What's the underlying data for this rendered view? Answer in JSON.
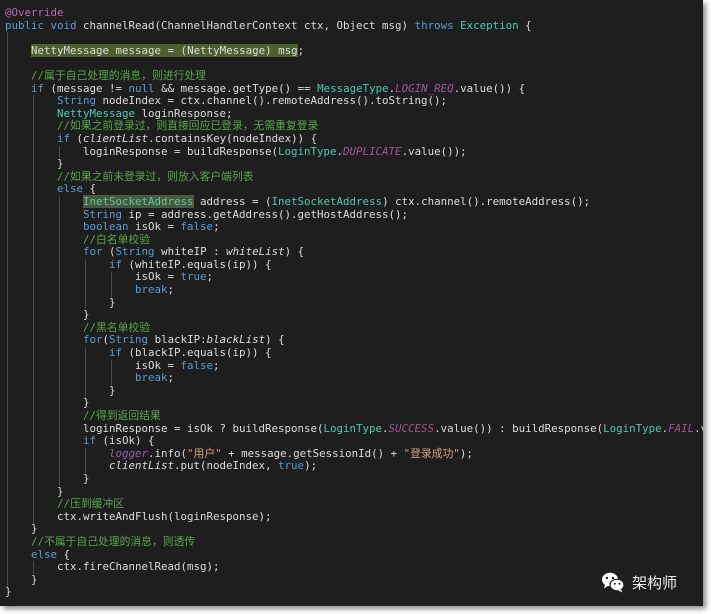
{
  "editor": {
    "lines": [
      [
        [
          "an",
          "@Override"
        ]
      ],
      [
        [
          "kw",
          "public"
        ],
        [
          "p",
          " "
        ],
        [
          "kw",
          "void"
        ],
        [
          "p",
          " channelRead(ChannelHandlerContext ctx, Object msg) "
        ],
        [
          "kw",
          "throws"
        ],
        [
          "p",
          " "
        ],
        [
          "ty",
          "Exception"
        ],
        [
          "p",
          " {"
        ]
      ],
      [],
      [
        [
          "p",
          "    "
        ],
        [
          "hl",
          "NettyMessage"
        ],
        [
          "hl",
          " message = "
        ],
        [
          "hl",
          "("
        ],
        [
          "hl",
          "NettyMessage"
        ],
        [
          "hl",
          ") msg"
        ],
        [
          "p",
          ";"
        ]
      ],
      [],
      [
        [
          "p",
          "    "
        ],
        [
          "cm",
          "//属于自己处理的消息，则进行处理"
        ]
      ],
      [
        [
          "p",
          "    "
        ],
        [
          "kw",
          "if"
        ],
        [
          "p",
          " (message != "
        ],
        [
          "kw",
          "null"
        ],
        [
          "p",
          " && message.getType() == "
        ],
        [
          "ty",
          "MessageType"
        ],
        [
          "p",
          "."
        ],
        [
          "cst",
          "LOGIN_REQ"
        ],
        [
          "p",
          ".value()) {"
        ]
      ],
      [
        [
          "p",
          "        "
        ],
        [
          "kw",
          "String"
        ],
        [
          "p",
          " nodeIndex = ctx.channel().remoteAddress().toString();"
        ]
      ],
      [
        [
          "p",
          "        "
        ],
        [
          "ty",
          "NettyMessage"
        ],
        [
          "p",
          " loginResponse;"
        ]
      ],
      [
        [
          "p",
          "        "
        ],
        [
          "cm",
          "//如果之前登录过，则直接回应已登录，无需重复登录"
        ]
      ],
      [
        [
          "p",
          "        "
        ],
        [
          "kw",
          "if"
        ],
        [
          "p",
          " ("
        ],
        [
          "fd",
          "clientList"
        ],
        [
          "p",
          ".containsKey(nodeIndex)) {"
        ]
      ],
      [
        [
          "p",
          "            loginResponse = buildResponse("
        ],
        [
          "ty",
          "LoginType"
        ],
        [
          "p",
          "."
        ],
        [
          "cst",
          "DUPLICATE"
        ],
        [
          "p",
          ".value());"
        ]
      ],
      [
        [
          "p",
          "        }"
        ]
      ],
      [
        [
          "p",
          "        "
        ],
        [
          "cm",
          "//如果之前未登录过，则放入客户端列表"
        ]
      ],
      [
        [
          "p",
          "        "
        ],
        [
          "kw",
          "else"
        ],
        [
          "p",
          " {"
        ]
      ],
      [
        [
          "p",
          "            "
        ],
        [
          "tyhl",
          "InetSocketAddress"
        ],
        [
          "p",
          " address = ("
        ],
        [
          "ty",
          "InetSocketAddress"
        ],
        [
          "p",
          ") ctx.channel().remoteAddress();"
        ]
      ],
      [
        [
          "p",
          "            "
        ],
        [
          "kw",
          "String"
        ],
        [
          "p",
          " ip = address.getAddress().getHostAddress();"
        ]
      ],
      [
        [
          "p",
          "            "
        ],
        [
          "kw",
          "boolean"
        ],
        [
          "p",
          " isOk = "
        ],
        [
          "kw",
          "false"
        ],
        [
          "p",
          ";"
        ]
      ],
      [
        [
          "p",
          "            "
        ],
        [
          "cm",
          "//白名单校验"
        ]
      ],
      [
        [
          "p",
          "            "
        ],
        [
          "kw",
          "for"
        ],
        [
          "p",
          " ("
        ],
        [
          "kw",
          "String"
        ],
        [
          "p",
          " whiteIP : "
        ],
        [
          "fd",
          "whiteList"
        ],
        [
          "p",
          ") {"
        ]
      ],
      [
        [
          "p",
          "                "
        ],
        [
          "kw",
          "if"
        ],
        [
          "p",
          " (whiteIP.equals(ip)) {"
        ]
      ],
      [
        [
          "p",
          "                    isOk = "
        ],
        [
          "kw",
          "true"
        ],
        [
          "p",
          ";"
        ]
      ],
      [
        [
          "p",
          "                    "
        ],
        [
          "kw",
          "break"
        ],
        [
          "p",
          ";"
        ]
      ],
      [
        [
          "p",
          "                }"
        ]
      ],
      [
        [
          "p",
          "            }"
        ]
      ],
      [
        [
          "p",
          "            "
        ],
        [
          "cm",
          "//黑名单校验"
        ]
      ],
      [
        [
          "p",
          "            "
        ],
        [
          "kw",
          "for"
        ],
        [
          "p",
          "("
        ],
        [
          "kw",
          "String"
        ],
        [
          "p",
          " blackIP:"
        ],
        [
          "fd",
          "blackList"
        ],
        [
          "p",
          ") {"
        ]
      ],
      [
        [
          "p",
          "                "
        ],
        [
          "kw",
          "if"
        ],
        [
          "p",
          " (blackIP.equals(ip)) {"
        ]
      ],
      [
        [
          "p",
          "                    isOk = "
        ],
        [
          "kw",
          "false"
        ],
        [
          "p",
          ";"
        ]
      ],
      [
        [
          "p",
          "                    "
        ],
        [
          "kw",
          "break"
        ],
        [
          "p",
          ";"
        ]
      ],
      [
        [
          "p",
          "                }"
        ]
      ],
      [
        [
          "p",
          "            }"
        ]
      ],
      [
        [
          "p",
          "            "
        ],
        [
          "cm",
          "//得到返回结果"
        ]
      ],
      [
        [
          "p",
          "            loginResponse = isOk ? buildResponse("
        ],
        [
          "ty",
          "LoginType"
        ],
        [
          "p",
          "."
        ],
        [
          "cst",
          "SUCCESS"
        ],
        [
          "p",
          ".value()) : buildResponse("
        ],
        [
          "ty",
          "LoginType"
        ],
        [
          "p",
          "."
        ],
        [
          "cst",
          "FAIL"
        ],
        [
          "p",
          ".value());"
        ]
      ],
      [
        [
          "p",
          "            "
        ],
        [
          "kw",
          "if"
        ],
        [
          "p",
          " (isOk) {"
        ]
      ],
      [
        [
          "p",
          "                "
        ],
        [
          "lg",
          "logger"
        ],
        [
          "p",
          ".info("
        ],
        [
          "st",
          "\"用户\""
        ],
        [
          "p",
          " + message.getSessionId() + "
        ],
        [
          "st",
          "\"登录成功\""
        ],
        [
          "p",
          ");"
        ]
      ],
      [
        [
          "p",
          "                "
        ],
        [
          "fd",
          "clientList"
        ],
        [
          "p",
          ".put(nodeIndex, "
        ],
        [
          "kw",
          "true"
        ],
        [
          "p",
          ");"
        ]
      ],
      [
        [
          "p",
          "            }"
        ]
      ],
      [
        [
          "p",
          "        }"
        ]
      ],
      [
        [
          "p",
          "        "
        ],
        [
          "cm",
          "//压到缓冲区"
        ]
      ],
      [
        [
          "p",
          "        ctx.writeAndFlush(loginResponse);"
        ]
      ],
      [
        [
          "p",
          "    }"
        ]
      ],
      [
        [
          "p",
          "    "
        ],
        [
          "cm",
          "//不属于自己处理的消息，则透传"
        ]
      ],
      [
        [
          "p",
          "    "
        ],
        [
          "kw",
          "else"
        ],
        [
          "p",
          " {"
        ]
      ],
      [
        [
          "p",
          "        ctx.fireChannelRead(msg);"
        ]
      ],
      [
        [
          "p",
          "    }"
        ]
      ],
      [
        [
          "p",
          "}"
        ]
      ]
    ]
  },
  "colors": {
    "background": "#1e1e1e",
    "keyword": "#569cd6",
    "type": "#4ec9b0",
    "comment": "#57a64a",
    "annotation": "#bd63c5",
    "string": "#d69d85",
    "constant": "#a0539c",
    "highlight": "#4e5e2c"
  },
  "watermark": {
    "icon": "wechat-icon",
    "text": "架构师"
  }
}
